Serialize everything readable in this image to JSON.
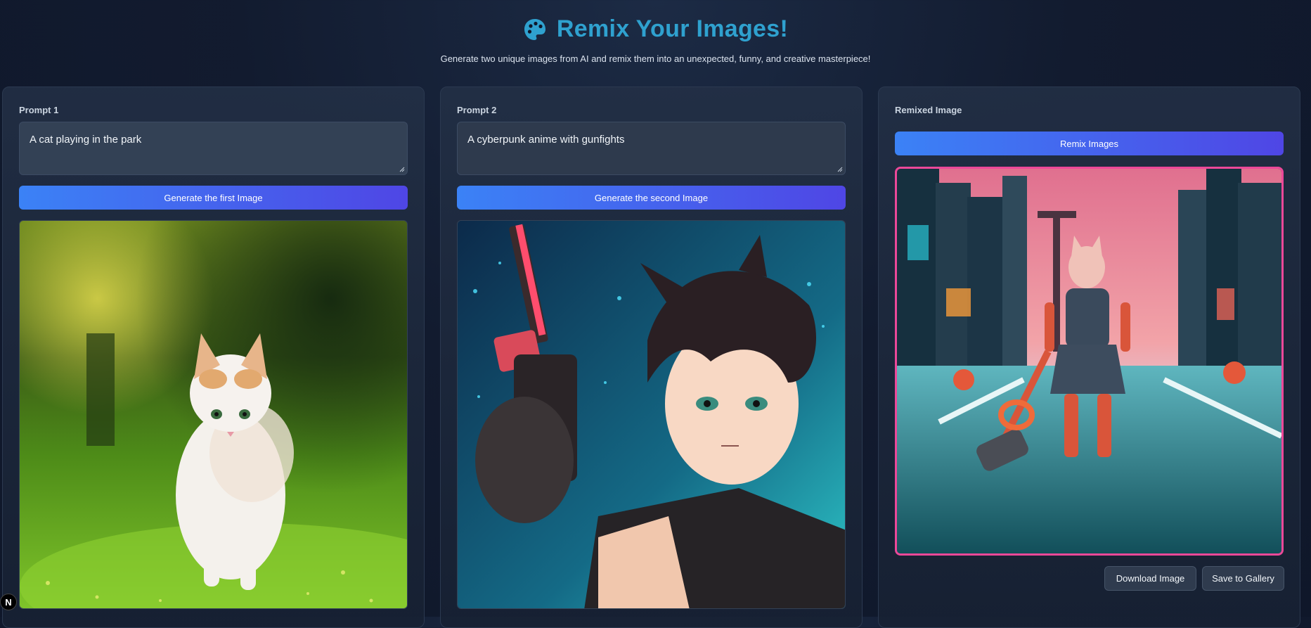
{
  "header": {
    "title": "Remix Your Images!",
    "subtitle": "Generate two unique images from AI and remix them into an unexpected, funny, and creative masterpiece!",
    "icon": "palette-icon"
  },
  "panel1": {
    "label": "Prompt 1",
    "prompt_value": "A cat playing in the park",
    "button_label": "Generate the first Image",
    "image": "kitten-in-park-image"
  },
  "panel2": {
    "label": "Prompt 2",
    "prompt_value": "A cyberpunk anime with gunfights",
    "button_label": "Generate the second Image",
    "image": "cyberpunk-anime-image"
  },
  "panel3": {
    "label": "Remixed Image",
    "remix_button_label": "Remix Images",
    "image": "remixed-cyberpunk-cat-image",
    "download_label": "Download Image",
    "gallery_label": "Save to Gallery"
  },
  "badge": {
    "label": "N"
  },
  "colors": {
    "accent_title": "#2fa1cf",
    "button_gradient_start": "#3b82f6",
    "button_gradient_end": "#4f46e5",
    "remix_border": "#ec4899"
  }
}
